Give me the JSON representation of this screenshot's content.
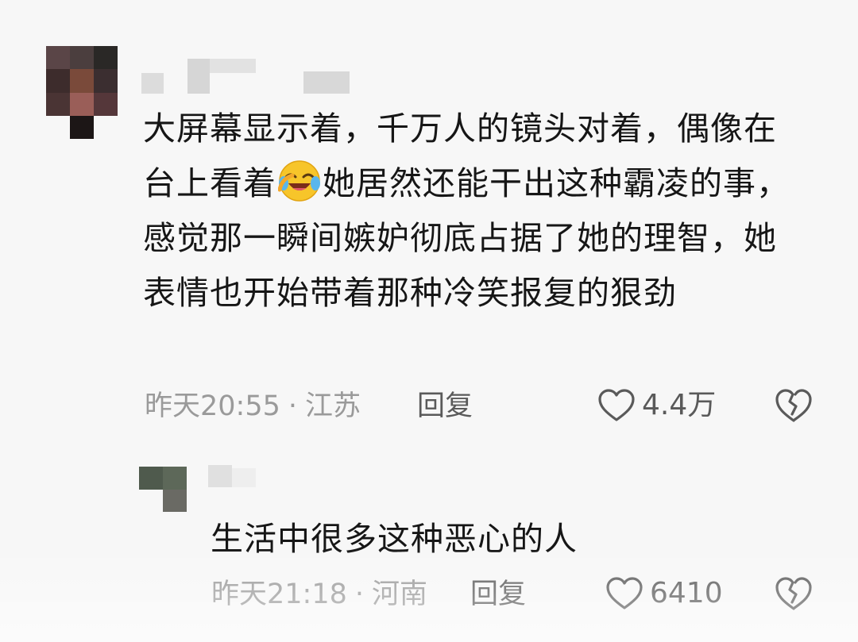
{
  "comments": [
    {
      "avatar_tiles": [
        "#5a4547",
        "#4b3e3e",
        "#2a2826",
        "#3d2c2c",
        "#7a4a3a",
        "#3b2e30",
        "#4a3434",
        "#9a5e58",
        "#55373a",
        "#f7f7f7",
        "#1c1616",
        "#f7f7f7"
      ],
      "username_blocks_color": "#d9d9d9",
      "text_before_emoji": "大屏幕显示着，千万人的镜头对着，偶像在台上看着",
      "emoji": "laughing-crying-emoji",
      "text_after_emoji": "她居然还能干出这种霸凌的事，感觉那一瞬间嫉妒彻底占据了她的理智，她表情也开始带着那种冷笑报复的狠劲",
      "time": "昨天20:55",
      "separator": "·",
      "location": "江苏",
      "reply_label": "回复",
      "like_count": "4.4万"
    },
    {
      "avatar_tiles": [
        "#4f5a4d",
        "#5d6859",
        "#f7f7f7",
        "#6a6a64"
      ],
      "username_blocks_color": "#dedede",
      "text": "生活中很多这种恶心的人",
      "time": "昨天21:18",
      "separator": "·",
      "location": "河南",
      "reply_label": "回复",
      "like_count": "6410"
    }
  ],
  "colors": {
    "background": "#f7f7f7",
    "meta_text": "#9a9a9a",
    "action_text": "#5a5a5a",
    "emoji_yellow": "#f7c52a"
  }
}
